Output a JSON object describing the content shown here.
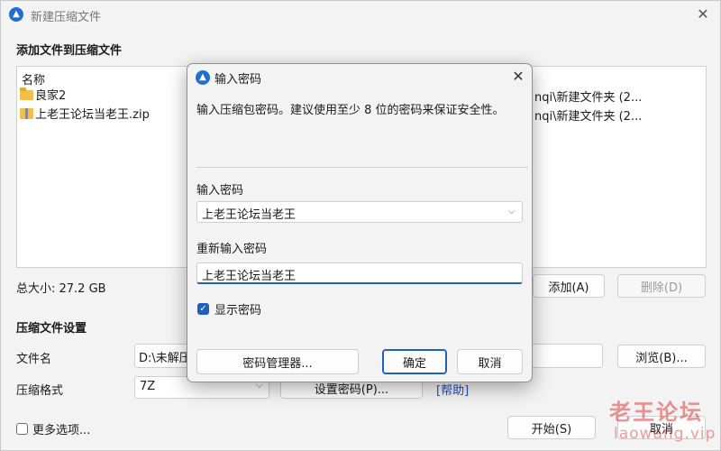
{
  "main": {
    "title": "新建压缩文件",
    "close_icon": "close-icon",
    "add_files_label": "添加文件到压缩文件",
    "file_list": {
      "column_name": "名称",
      "rows": [
        {
          "name": "良家2",
          "icon": "folder-icon",
          "path": "nqi\\新建文件夹 (2..."
        },
        {
          "name": "上老王论坛当老王.zip",
          "icon": "zip-icon",
          "path": "nqi\\新建文件夹 (2..."
        }
      ]
    },
    "total_size": "总大小: 27.2 GB",
    "add_button": "添加(A)",
    "delete_button": "删除(D)",
    "compress_settings_label": "压缩文件设置",
    "filename_label": "文件名",
    "filename_value": "D:\\未解压",
    "browse_button": "浏览(B)...",
    "format_label": "压缩格式",
    "format_value": "7Z",
    "set_password_button": "设置密码(P)...",
    "help_link": "[帮助]",
    "more_options": "更多选项...",
    "start_button": "开始(S)",
    "cancel_button": "取消"
  },
  "dialog": {
    "title": "输入密码",
    "message": "输入压缩包密码。建议使用至少 8 位的密码来保证安全性。",
    "password_label": "输入密码",
    "password_value": "上老王论坛当老王",
    "confirm_label": "重新输入密码",
    "confirm_value": "上老王论坛当老王",
    "show_password_label": "显示密码",
    "show_password_checked": true,
    "password_manager_button": "密码管理器...",
    "ok_button": "确定",
    "cancel_button": "取消"
  },
  "watermark": {
    "text": "老王论坛",
    "url": "laowang.vip"
  },
  "colors": {
    "accent": "#1f5fbf",
    "watermark": "#de3c3c"
  }
}
